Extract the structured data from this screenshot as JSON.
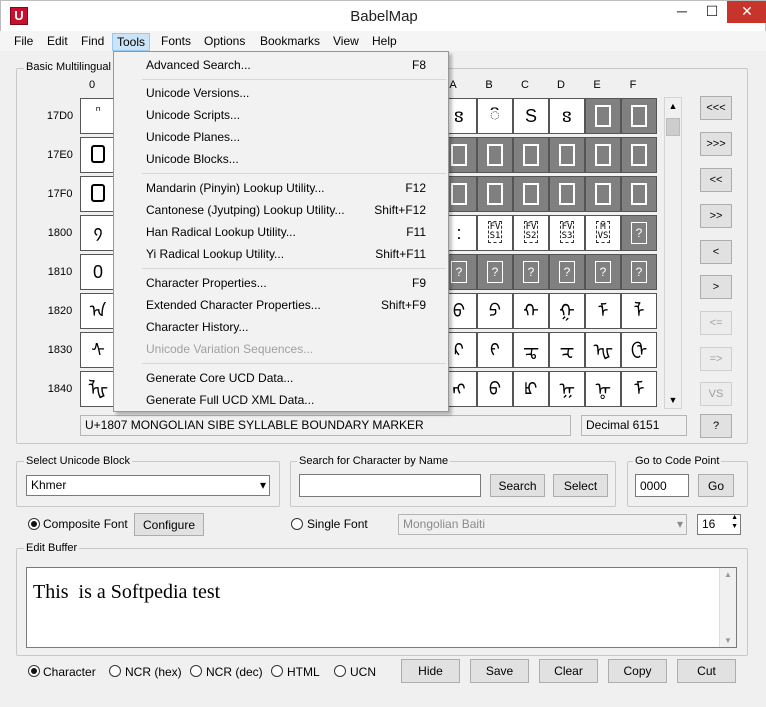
{
  "window": {
    "title": "BabelMap",
    "icon_letter": "U",
    "min": "─",
    "max": "☐",
    "close": "✕"
  },
  "menubar": [
    "File",
    "Edit",
    "Find",
    "Tools",
    "Fonts",
    "Options",
    "Bookmarks",
    "View",
    "Help"
  ],
  "grid": {
    "group_label": "Basic Multilingual",
    "col_headers": [
      "0",
      "A",
      "B",
      "C",
      "D",
      "E",
      "F"
    ],
    "row_headers": [
      "17D0",
      "17E0",
      "17F0",
      "1800",
      "1810",
      "1820",
      "1830",
      "1840"
    ],
    "col0": [
      "ᷠ",
      "",
      "",
      "᠀",
      "0",
      "ᠠ",
      "ᠰ",
      "ᡀ"
    ],
    "right_cols": [
      [
        "ៜ",
        "៝",
        "S",
        "ៜ",
        "",
        ""
      ],
      [
        "",
        "",
        "",
        "",
        "",
        ""
      ],
      [
        "",
        "",
        "",
        "",
        "",
        ""
      ],
      [
        ":",
        "·",
        "FV|S1",
        "FV|S2",
        "FV|S3",
        "M|VS"
      ],
      [
        "",
        "",
        "",
        "",
        "",
        ""
      ],
      [
        "ᠪ",
        "ᠫ",
        "ᠬ",
        "ᠭ",
        "ᠮ",
        "ᠯ"
      ],
      [
        "ᠺ",
        "ᠻ",
        "ᠼ",
        "ᠽ",
        "ᠾ",
        "ᠿ"
      ],
      [
        "ᡊ",
        "ᡋ",
        "ᡌ",
        "ᡍ",
        "ᡎ",
        "ᡏ"
      ]
    ],
    "nav_buttons": [
      "<<<",
      ">>>",
      "<<",
      ">>",
      "<",
      ">",
      "<=",
      "=>",
      "VS",
      "?"
    ],
    "status_name": "U+1807 MONGOLIAN SIBE SYLLABLE BOUNDARY MARKER",
    "status_decimal": "Decimal 6151"
  },
  "unicode_block": {
    "label": "Select Unicode Block",
    "value": "Khmer"
  },
  "search": {
    "label": "Search for Character by Name",
    "value": "",
    "search_button": "Search",
    "select_button": "Select"
  },
  "goto": {
    "label": "Go to Code Point",
    "value": "0000",
    "button": "Go"
  },
  "font": {
    "composite_label": "Composite Font",
    "configure_button": "Configure",
    "single_label": "Single Font",
    "single_value": "Mongolian Baiti",
    "size": "16"
  },
  "edit_buffer": {
    "label": "Edit Buffer",
    "text": "This  is a Softpedia test"
  },
  "output_modes": [
    "Character",
    "NCR (hex)",
    "NCR (dec)",
    "HTML",
    "UCN"
  ],
  "buffer_buttons": [
    "Hide",
    "Save",
    "Clear",
    "Copy",
    "Cut"
  ],
  "tools_menu": {
    "items": [
      {
        "label": "Advanced Search...",
        "accel": "F8"
      },
      {
        "label": "Unicode Versions...",
        "accel": ""
      },
      {
        "label": "Unicode Scripts...",
        "accel": ""
      },
      {
        "label": "Unicode Planes...",
        "accel": ""
      },
      {
        "label": "Unicode Blocks...",
        "accel": ""
      },
      {
        "label": "Mandarin (Pinyin) Lookup Utility...",
        "accel": "F12"
      },
      {
        "label": "Cantonese (Jyutping) Lookup Utility...",
        "accel": "Shift+F12"
      },
      {
        "label": "Han Radical Lookup Utility...",
        "accel": "F11"
      },
      {
        "label": "Yi Radical Lookup Utility...",
        "accel": "Shift+F11"
      },
      {
        "label": "Character Properties...",
        "accel": "F9"
      },
      {
        "label": "Extended Character Properties...",
        "accel": "Shift+F9"
      },
      {
        "label": "Character History...",
        "accel": ""
      },
      {
        "label": "Unicode Variation Sequences...",
        "accel": ""
      },
      {
        "label": "Generate Core UCD Data...",
        "accel": ""
      },
      {
        "label": "Generate Full UCD XML Data...",
        "accel": ""
      }
    ]
  }
}
